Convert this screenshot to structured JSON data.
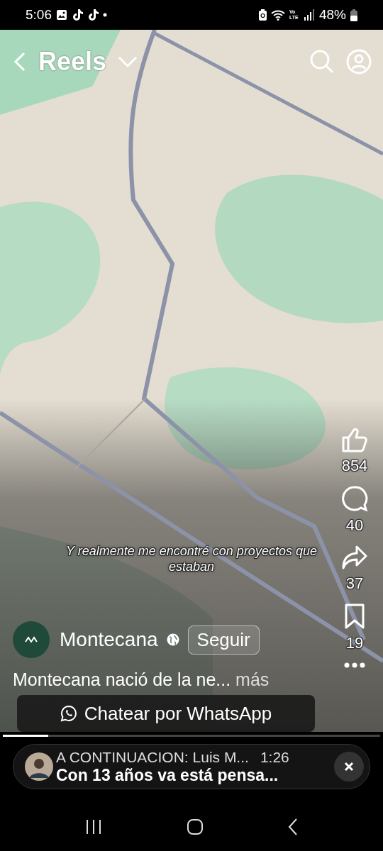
{
  "status_bar": {
    "time": "5:06",
    "network": "Vo LTE",
    "battery": "48%"
  },
  "header": {
    "title": "Reels"
  },
  "video": {
    "kind": "picture",
    "subtitle": "Y realmente me encontré con proyectos que estaban"
  },
  "actions": [
    {
      "kind": "like",
      "count": "854"
    },
    {
      "kind": "comment",
      "count": "40"
    },
    {
      "kind": "share",
      "count": "37"
    },
    {
      "kind": "save",
      "count": "19"
    },
    {
      "kind": "more"
    }
  ],
  "author": {
    "name": "Montecana",
    "follow_label": "Seguir"
  },
  "caption": {
    "text": "Montecana nació de la ne...",
    "more": "más"
  },
  "cta": {
    "label": "Chatear por WhatsApp"
  },
  "progress": {
    "level": 0.12
  },
  "up_next": {
    "title": "A CONTINUACION: Luis M...",
    "duration": "1:26",
    "subtitle": "Con 13 años va está pensa..."
  }
}
